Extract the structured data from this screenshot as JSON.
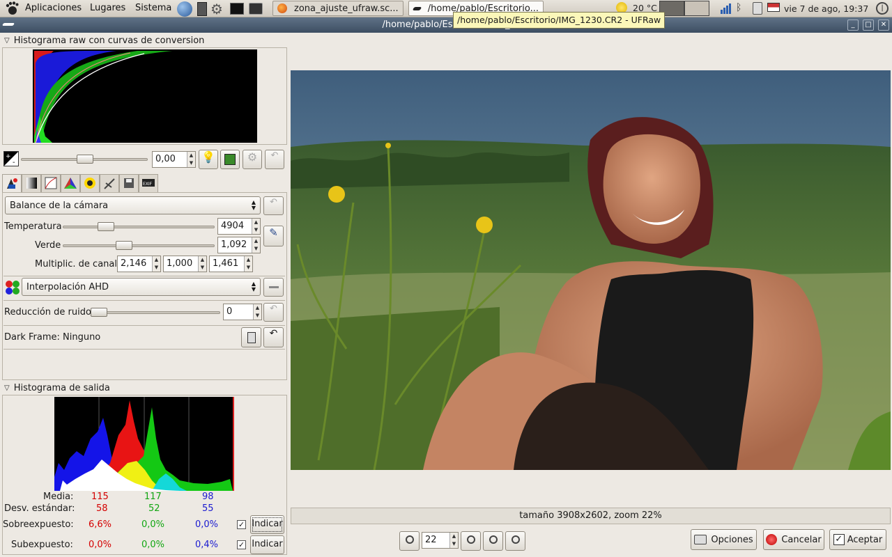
{
  "top_panel": {
    "menus": [
      "Aplicaciones",
      "Lugares",
      "Sistema"
    ],
    "tasks": [
      {
        "label": "zona_ajuste_ufraw.sc..."
      },
      {
        "label": "/home/pablo/Escritorio..."
      }
    ],
    "weather": "20 °C",
    "clock": "vie  7 de ago, 19:37",
    "icons": [
      "gnome-foot-icon",
      "globe-icon",
      "notes-icon",
      "gear-icon",
      "terminal-icon",
      "screenshot-icon",
      "firefox-icon",
      "weather-sun-icon",
      "network-bars-icon",
      "bluetooth-icon",
      "trash-icon",
      "flag-icon",
      "power-icon"
    ]
  },
  "window": {
    "title": "/home/pablo/Escritorio/IMG_",
    "tooltip": "/home/pablo/Escritorio/IMG_1230.CR2 - UFRaw"
  },
  "raw_histogram": {
    "title": "Histograma raw con curvas de conversion"
  },
  "exposure": {
    "value": "0,00"
  },
  "white_balance": {
    "preset": "Balance de la cámara",
    "temperature_label": "Temperatura",
    "temperature": "4904",
    "temperature_frac": 0.26,
    "green_label": "Verde",
    "green": "1,092",
    "green_frac": 0.39,
    "channel_label": "Multiplic. de canal:",
    "channel": [
      "2,146",
      "1,000",
      "1,461"
    ]
  },
  "interpolation": {
    "value": "Interpolación AHD"
  },
  "noise": {
    "label": "Reducción de ruido",
    "value": "0"
  },
  "dark_frame": {
    "label": "Dark Frame: Ninguno"
  },
  "output_histogram": {
    "title": "Histograma de salida",
    "rows": [
      {
        "label": "Media:",
        "r": "115",
        "g": "117",
        "b": "98"
      },
      {
        "label": "Desv. estándar:",
        "r": "58",
        "g": "52",
        "b": "55"
      }
    ],
    "over": {
      "label": "Sobreexpuesto:",
      "r": "6,6%",
      "g": "0,0%",
      "b": "0,0%",
      "button": "Indicar"
    },
    "under": {
      "label": "Subexpuesto:",
      "r": "0,0%",
      "g": "0,0%",
      "b": "0,4%",
      "button": "Indicar"
    }
  },
  "preview": {
    "status": "tamaño 3908x2602, zoom 22%",
    "zoom": "22"
  },
  "actions": {
    "options": "Opciones",
    "cancel": "Cancelar",
    "accept": "Aceptar"
  },
  "colors": {
    "title_bar": "#4a5b6f",
    "tooltip": "#fbf7b9",
    "red": "#d40000",
    "green": "#12a612",
    "blue": "#1a1ad0"
  }
}
